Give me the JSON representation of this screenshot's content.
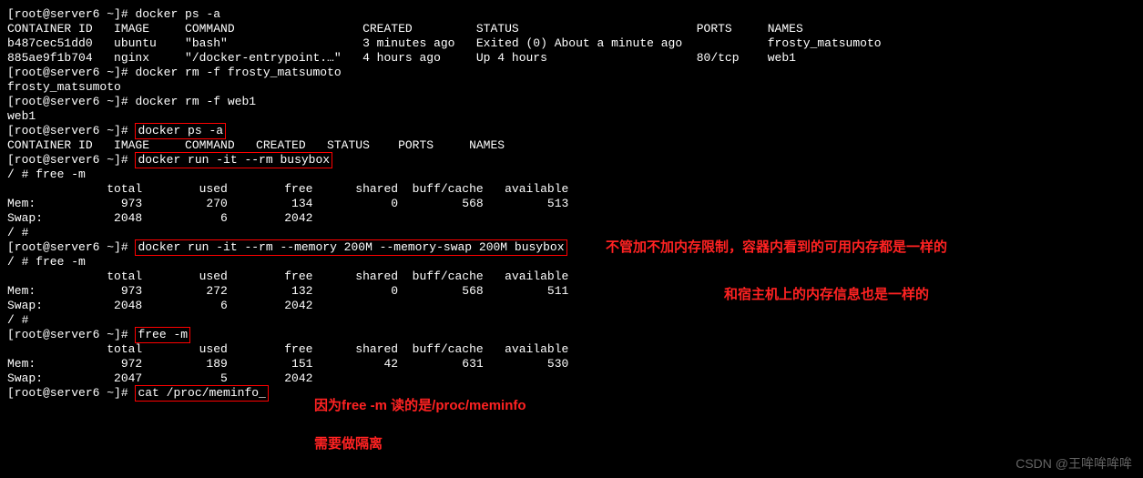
{
  "prompt": "[root@server6 ~]# ",
  "cmd": {
    "ps_a_1": "docker ps -a",
    "rm_frosty": "docker rm -f frosty_matsumoto",
    "rm_web1": "docker rm -f web1",
    "ps_a_2": "docker ps -a",
    "run_busybox": "docker run -it --rm busybox",
    "run_busybox_mem": "docker run -it --rm --memory 200M --memory-swap 200M busybox",
    "free_m_host": "free -m",
    "cat_meminfo": "cat /proc/meminfo_",
    "free_prompt": "/ # free -m",
    "slash_prompt": "/ #"
  },
  "ps_headers_1": "CONTAINER ID   IMAGE     COMMAND                  CREATED         STATUS                         PORTS     NAMES",
  "ps_row_1": "b487cec51dd0   ubuntu    \"bash\"                   3 minutes ago   Exited (0) About a minute ago            frosty_matsumoto",
  "ps_row_2": "885ae9f1b704   nginx     \"/docker-entrypoint.…\"   4 hours ago     Up 4 hours                     80/tcp    web1",
  "out_frosty": "frosty_matsumoto",
  "out_web1": "web1",
  "ps_headers_2": "CONTAINER ID   IMAGE     COMMAND   CREATED   STATUS    PORTS     NAMES",
  "free_header": "              total        used        free      shared  buff/cache   available",
  "free1_mem": "Mem:            973         270         134           0         568         513",
  "free1_swap": "Swap:          2048           6        2042",
  "free2_mem": "Mem:            973         272         132           0         568         511",
  "free2_swap": "Swap:          2048           6        2042",
  "free3_mem": "Mem:            972         189         151          42         631         530",
  "free3_swap": "Swap:          2047           5        2042",
  "anno1": "不管加不加内存限制，容器内看到的可用内存都是一样的",
  "anno2": "和宿主机上的内存信息也是一样的",
  "anno3": "因为free -m 读的是/proc/meminfo",
  "anno4": "需要做隔离",
  "watermark": "CSDN @王哞哞哞哞"
}
